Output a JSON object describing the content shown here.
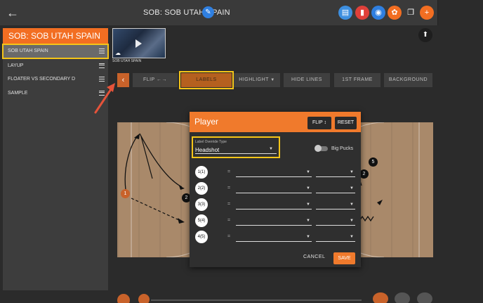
{
  "header": {
    "title": "SOB: SOB UTAH SPAIN",
    "icons": [
      "back-arrow-icon",
      "edit-icon",
      "stats-icon",
      "delete-icon",
      "view-icon",
      "share-icon",
      "copy-icon",
      "add-icon"
    ],
    "colors": {
      "stats": "#3d8fe0",
      "delete": "#e0403a",
      "view": "#2f7fe0",
      "share": "#f26e22",
      "add": "#f26e22"
    }
  },
  "sidebar": {
    "title": "SOB: SOB UTAH SPAIN",
    "items": [
      {
        "label": "SOB UTAH SPAIN"
      },
      {
        "label": "LAYUP"
      },
      {
        "label": "FLOATER VS SECONDARY D"
      },
      {
        "label": "SAMPLE"
      }
    ]
  },
  "video": {
    "label": "SOB UTAH SPAIN"
  },
  "toolbar": {
    "flip": "FLIP ←→",
    "labels": "LABELS",
    "highlight": "HIGHLIGHT",
    "hide_lines": "HIDE LINES",
    "first_frame": "1ST FRAME",
    "background": "BACKGROUND"
  },
  "court": {
    "players": [
      {
        "label": "1"
      },
      {
        "label": "2"
      },
      {
        "label": "2"
      },
      {
        "label": "5"
      }
    ]
  },
  "dialog": {
    "title": "Player",
    "flip": "FLIP ↕",
    "reset": "RESET",
    "override_label": "Label Override Type",
    "override_value": "Headshot",
    "big_pucks": "Big Pucks",
    "rows": [
      {
        "label": "1(1)",
        "eq": "="
      },
      {
        "label": "2(2)",
        "eq": "="
      },
      {
        "label": "3(3)",
        "eq": "="
      },
      {
        "label": "5(4)",
        "eq": "="
      },
      {
        "label": "4(5)",
        "eq": "="
      }
    ],
    "cancel": "CANCEL",
    "save": "SAVE"
  }
}
